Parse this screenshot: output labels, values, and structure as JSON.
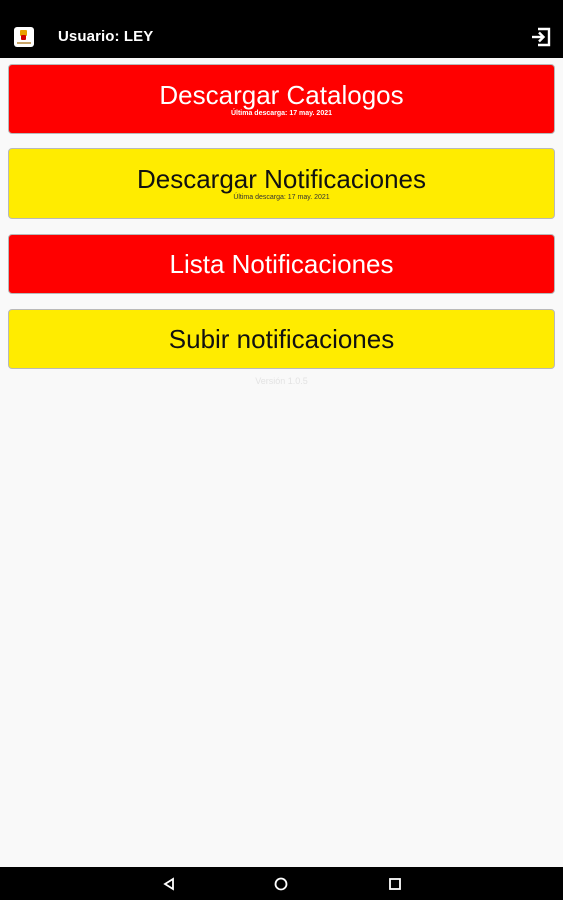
{
  "header": {
    "user_label": "Usuario: LEY",
    "logout_icon": "logout-icon"
  },
  "buttons": [
    {
      "label": "Descargar Catalogos",
      "sublabel": "Última descarga: 17 may. 2021",
      "color": "#ff0000"
    },
    {
      "label": "Descargar Notificaciones",
      "sublabel": "Última descarga: 17 may. 2021",
      "color": "#ffec00"
    },
    {
      "label": "Lista Notificaciones",
      "color": "#ff0000"
    },
    {
      "label": "Subir notificaciones",
      "color": "#ffec00"
    }
  ],
  "version": "Versión 1.0.5",
  "navigation": {
    "back_icon": "back-triangle-icon",
    "home_icon": "home-circle-icon",
    "recent_icon": "recent-apps-square-icon"
  }
}
